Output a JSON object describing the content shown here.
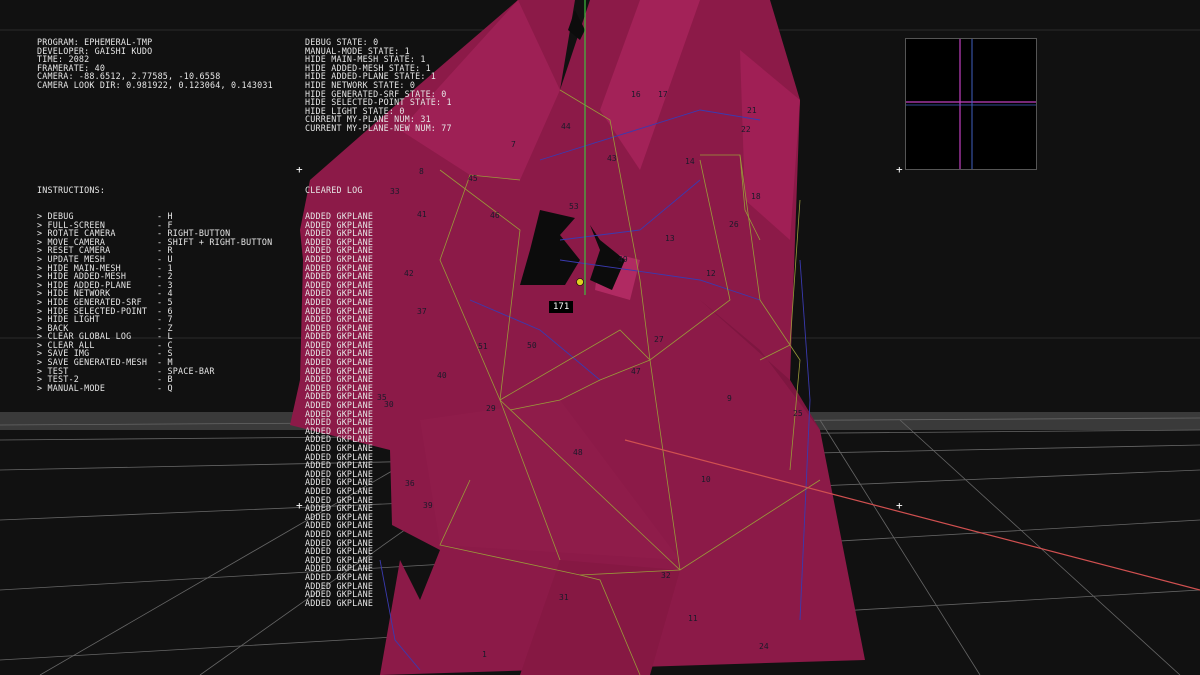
{
  "info": [
    "PROGRAM: EPHEMERAL-TMP",
    "DEVELOPER: GAISHI KUDO",
    "TIME: 2082",
    "FRAMERATE: 40",
    "CAMERA: -88.6512, 2.77585, -10.6558",
    "CAMERA LOOK DIR: 0.981922, 0.123064, 0.143031"
  ],
  "states": [
    "DEBUG STATE: 0",
    "MANUAL-MODE STATE: 1",
    "HIDE MAIN-MESH STATE: 1",
    "HIDE ADDED-MESH STATE: 1",
    "HIDE ADDED-PLANE STATE: 1",
    "HIDE NETWORK STATE: 0",
    "HIDE GENERATED-SRF STATE: 0",
    "HIDE SELECTED-POINT STATE: 1",
    "HIDE LIGHT STATE: 0",
    "CURRENT MY-PLANE NUM: 31",
    "CURRENT MY-PLANE-NEW NUM: 77"
  ],
  "instructions_title": "INSTRUCTIONS:",
  "instructions": [
    {
      "action": "> DEBUG",
      "key": "- H"
    },
    {
      "action": "> FULL-SCREEN",
      "key": "- F"
    },
    {
      "action": "> ROTATE CAMERA",
      "key": "- RIGHT-BUTTON"
    },
    {
      "action": "> MOVE CAMERA",
      "key": "- SHIFT + RIGHT-BUTTON"
    },
    {
      "action": "> RESET CAMERA",
      "key": "- R"
    },
    {
      "action": "> UPDATE MESH",
      "key": "- U"
    },
    {
      "action": "> HIDE MAIN-MESH",
      "key": "- 1"
    },
    {
      "action": "> HIDE ADDED-MESH",
      "key": "- 2"
    },
    {
      "action": "> HIDE ADDED-PLANE",
      "key": "- 3"
    },
    {
      "action": "> HIDE NETWORK",
      "key": "- 4"
    },
    {
      "action": "> HIDE GENERATED-SRF",
      "key": "- 5"
    },
    {
      "action": "> HIDE SELECTED-POINT",
      "key": "- 6"
    },
    {
      "action": "> HIDE LIGHT",
      "key": "- 7"
    },
    {
      "action": "> BACK",
      "key": "- Z"
    },
    {
      "action": "> CLEAR GLOBAL LOG",
      "key": "- L"
    },
    {
      "action": "> CLEAR ALL",
      "key": "- C"
    },
    {
      "action": "> SAVE IMG",
      "key": "- S"
    },
    {
      "action": "> SAVE GENERATED-MESH",
      "key": "- M"
    },
    {
      "action": "> TEST",
      "key": "- SPACE-BAR"
    },
    {
      "action": "> TEST-2",
      "key": "- B"
    },
    {
      "action": "> MANUAL-MODE",
      "key": "- Q"
    }
  ],
  "log_header": "CLEARED LOG",
  "log_entry": "ADDED GKPLANE",
  "log_count": 46,
  "selected_point_label": "171",
  "plane_labels": [
    "1",
    "7",
    "8",
    "9",
    "10",
    "11",
    "12",
    "13",
    "14",
    "16",
    "17",
    "18",
    "21",
    "22",
    "24",
    "25",
    "26",
    "27",
    "29",
    "30",
    "31",
    "32",
    "33",
    "35",
    "36",
    "37",
    "39",
    "40",
    "41",
    "42",
    "43",
    "44",
    "45",
    "46",
    "47",
    "48",
    "49",
    "50",
    "51",
    "53"
  ],
  "colors": {
    "background": "#101010",
    "mesh": "#8c1a48",
    "mesh_light": "#a01f55",
    "edge": "#9a9a3a",
    "network": "#3a3aa0",
    "axis_y": "#3fbf3f",
    "axis_x": "#d05050",
    "minimap_line": "#c040c0"
  }
}
